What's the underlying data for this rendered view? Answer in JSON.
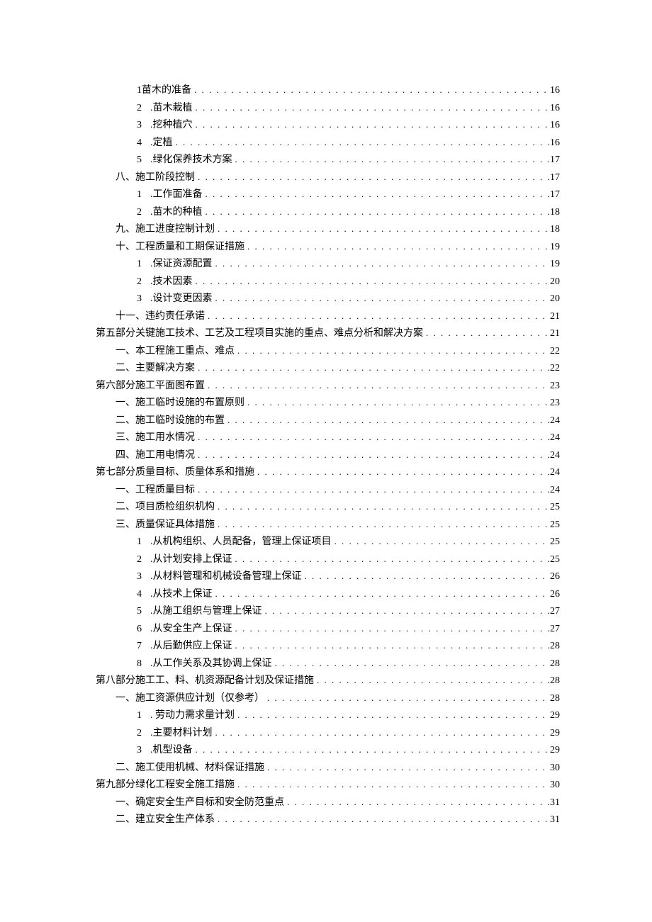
{
  "entries": [
    {
      "indent": 2,
      "num": "1",
      "label": "苗木的准备",
      "page": "16",
      "numgap": false
    },
    {
      "indent": 2,
      "num": "2",
      "label": ".苗木栽植",
      "page": "16",
      "numgap": true
    },
    {
      "indent": 2,
      "num": "3",
      "label": ".挖种植穴",
      "page": "16",
      "numgap": true
    },
    {
      "indent": 2,
      "num": "4",
      "label": ".定植",
      "page": "16",
      "numgap": true
    },
    {
      "indent": 2,
      "num": "5",
      "label": ".绿化保养技术方案",
      "page": "17",
      "numgap": true
    },
    {
      "indent": 1,
      "num": "",
      "label": "八、施工阶段控制",
      "page": "17"
    },
    {
      "indent": 2,
      "num": "1",
      "label": ".工作面准备",
      "page": "17",
      "numgap": true
    },
    {
      "indent": 2,
      "num": "2",
      "label": ".苗木的种植",
      "page": "18",
      "numgap": true
    },
    {
      "indent": 1,
      "num": "",
      "label": "九、施工进度控制计划",
      "page": "18"
    },
    {
      "indent": 1,
      "num": "",
      "label": "十、工程质量和工期保证措施",
      "page": "19"
    },
    {
      "indent": 2,
      "num": "1",
      "label": ".保证资源配置",
      "page": "19",
      "numgap": true
    },
    {
      "indent": 2,
      "num": "2",
      "label": ".技术因素",
      "page": "20",
      "numgap": true
    },
    {
      "indent": 2,
      "num": "3",
      "label": ".设计变更因素",
      "page": "20",
      "numgap": true
    },
    {
      "indent": 1,
      "num": "",
      "label": "十一、违约责任承诺",
      "page": "21"
    },
    {
      "indent": 0,
      "num": "",
      "label": "第五部分关键施工技术、工艺及工程项目实施的重点、难点分析和解决方案",
      "page": "21"
    },
    {
      "indent": 1,
      "num": "",
      "label": "一、本工程施工重点、难点",
      "page": "22"
    },
    {
      "indent": 1,
      "num": "",
      "label": "二、主要解决方案",
      "page": "22"
    },
    {
      "indent": 0,
      "num": "",
      "label": "第六部分施工平面图布置",
      "page": "23"
    },
    {
      "indent": 1,
      "num": "",
      "label": "一、施工临时设施的布置原则",
      "page": "23"
    },
    {
      "indent": 1,
      "num": "",
      "label": "二、施工临时设施的布置",
      "page": "24"
    },
    {
      "indent": 1,
      "num": "",
      "label": "三、施工用水情况",
      "page": "24"
    },
    {
      "indent": 1,
      "num": "",
      "label": "四、施工用电情况",
      "page": "24"
    },
    {
      "indent": 0,
      "num": "",
      "label": "第七部分质量目标、质量体系和措施",
      "page": "24"
    },
    {
      "indent": 1,
      "num": "",
      "label": "一、工程质量目标",
      "page": "24"
    },
    {
      "indent": 1,
      "num": "",
      "label": "二、项目质检组织机构",
      "page": "25"
    },
    {
      "indent": 1,
      "num": "",
      "label": "三、质量保证具体措施",
      "page": "25"
    },
    {
      "indent": 2,
      "num": "1",
      "label": ".从机构组织、人员配备，管理上保证项目",
      "page": "25",
      "numgap": true
    },
    {
      "indent": 2,
      "num": "2",
      "label": ".从计划安排上保证",
      "page": "25",
      "numgap": true
    },
    {
      "indent": 2,
      "num": "3",
      "label": ".从材料管理和机械设备管理上保证",
      "page": "26",
      "numgap": true
    },
    {
      "indent": 2,
      "num": "4",
      "label": ".从技术上保证",
      "page": "26",
      "numgap": true
    },
    {
      "indent": 2,
      "num": "5",
      "label": ".从施工组织与管理上保证",
      "page": "27",
      "numgap": true
    },
    {
      "indent": 2,
      "num": "6",
      "label": ".从安全生产上保证",
      "page": "27",
      "numgap": true
    },
    {
      "indent": 2,
      "num": "7",
      "label": ".从后勤供应上保证",
      "page": "28",
      "numgap": true
    },
    {
      "indent": 2,
      "num": "8",
      "label": ".从工作关系及其协调上保证",
      "page": "28",
      "numgap": true
    },
    {
      "indent": 0,
      "num": "",
      "label": "第八部分施工工、料、机资源配备计划及保证措施",
      "page": "28"
    },
    {
      "indent": 1,
      "num": "",
      "label": "一、施工资源供应计划（仅参考）",
      "page": "28"
    },
    {
      "indent": 2,
      "num": "1",
      "label": ". 劳动力需求量计划",
      "page": "29",
      "numgap": true
    },
    {
      "indent": 2,
      "num": "2",
      "label": ".主要材料计划",
      "page": "29",
      "numgap": true
    },
    {
      "indent": 2,
      "num": "3",
      "label": ".机型设备",
      "page": "29",
      "numgap": true
    },
    {
      "indent": 1,
      "num": "",
      "label": "二、施工使用机械、材料保证措施",
      "page": "30"
    },
    {
      "indent": 0,
      "num": "",
      "label": "第九部分绿化工程安全施工措施",
      "page": "30"
    },
    {
      "indent": 1,
      "num": "",
      "label": "一、确定安全生产目标和安全防范重点",
      "page": "31"
    },
    {
      "indent": 1,
      "num": "",
      "label": "二、建立安全生产体系",
      "page": "31"
    }
  ]
}
